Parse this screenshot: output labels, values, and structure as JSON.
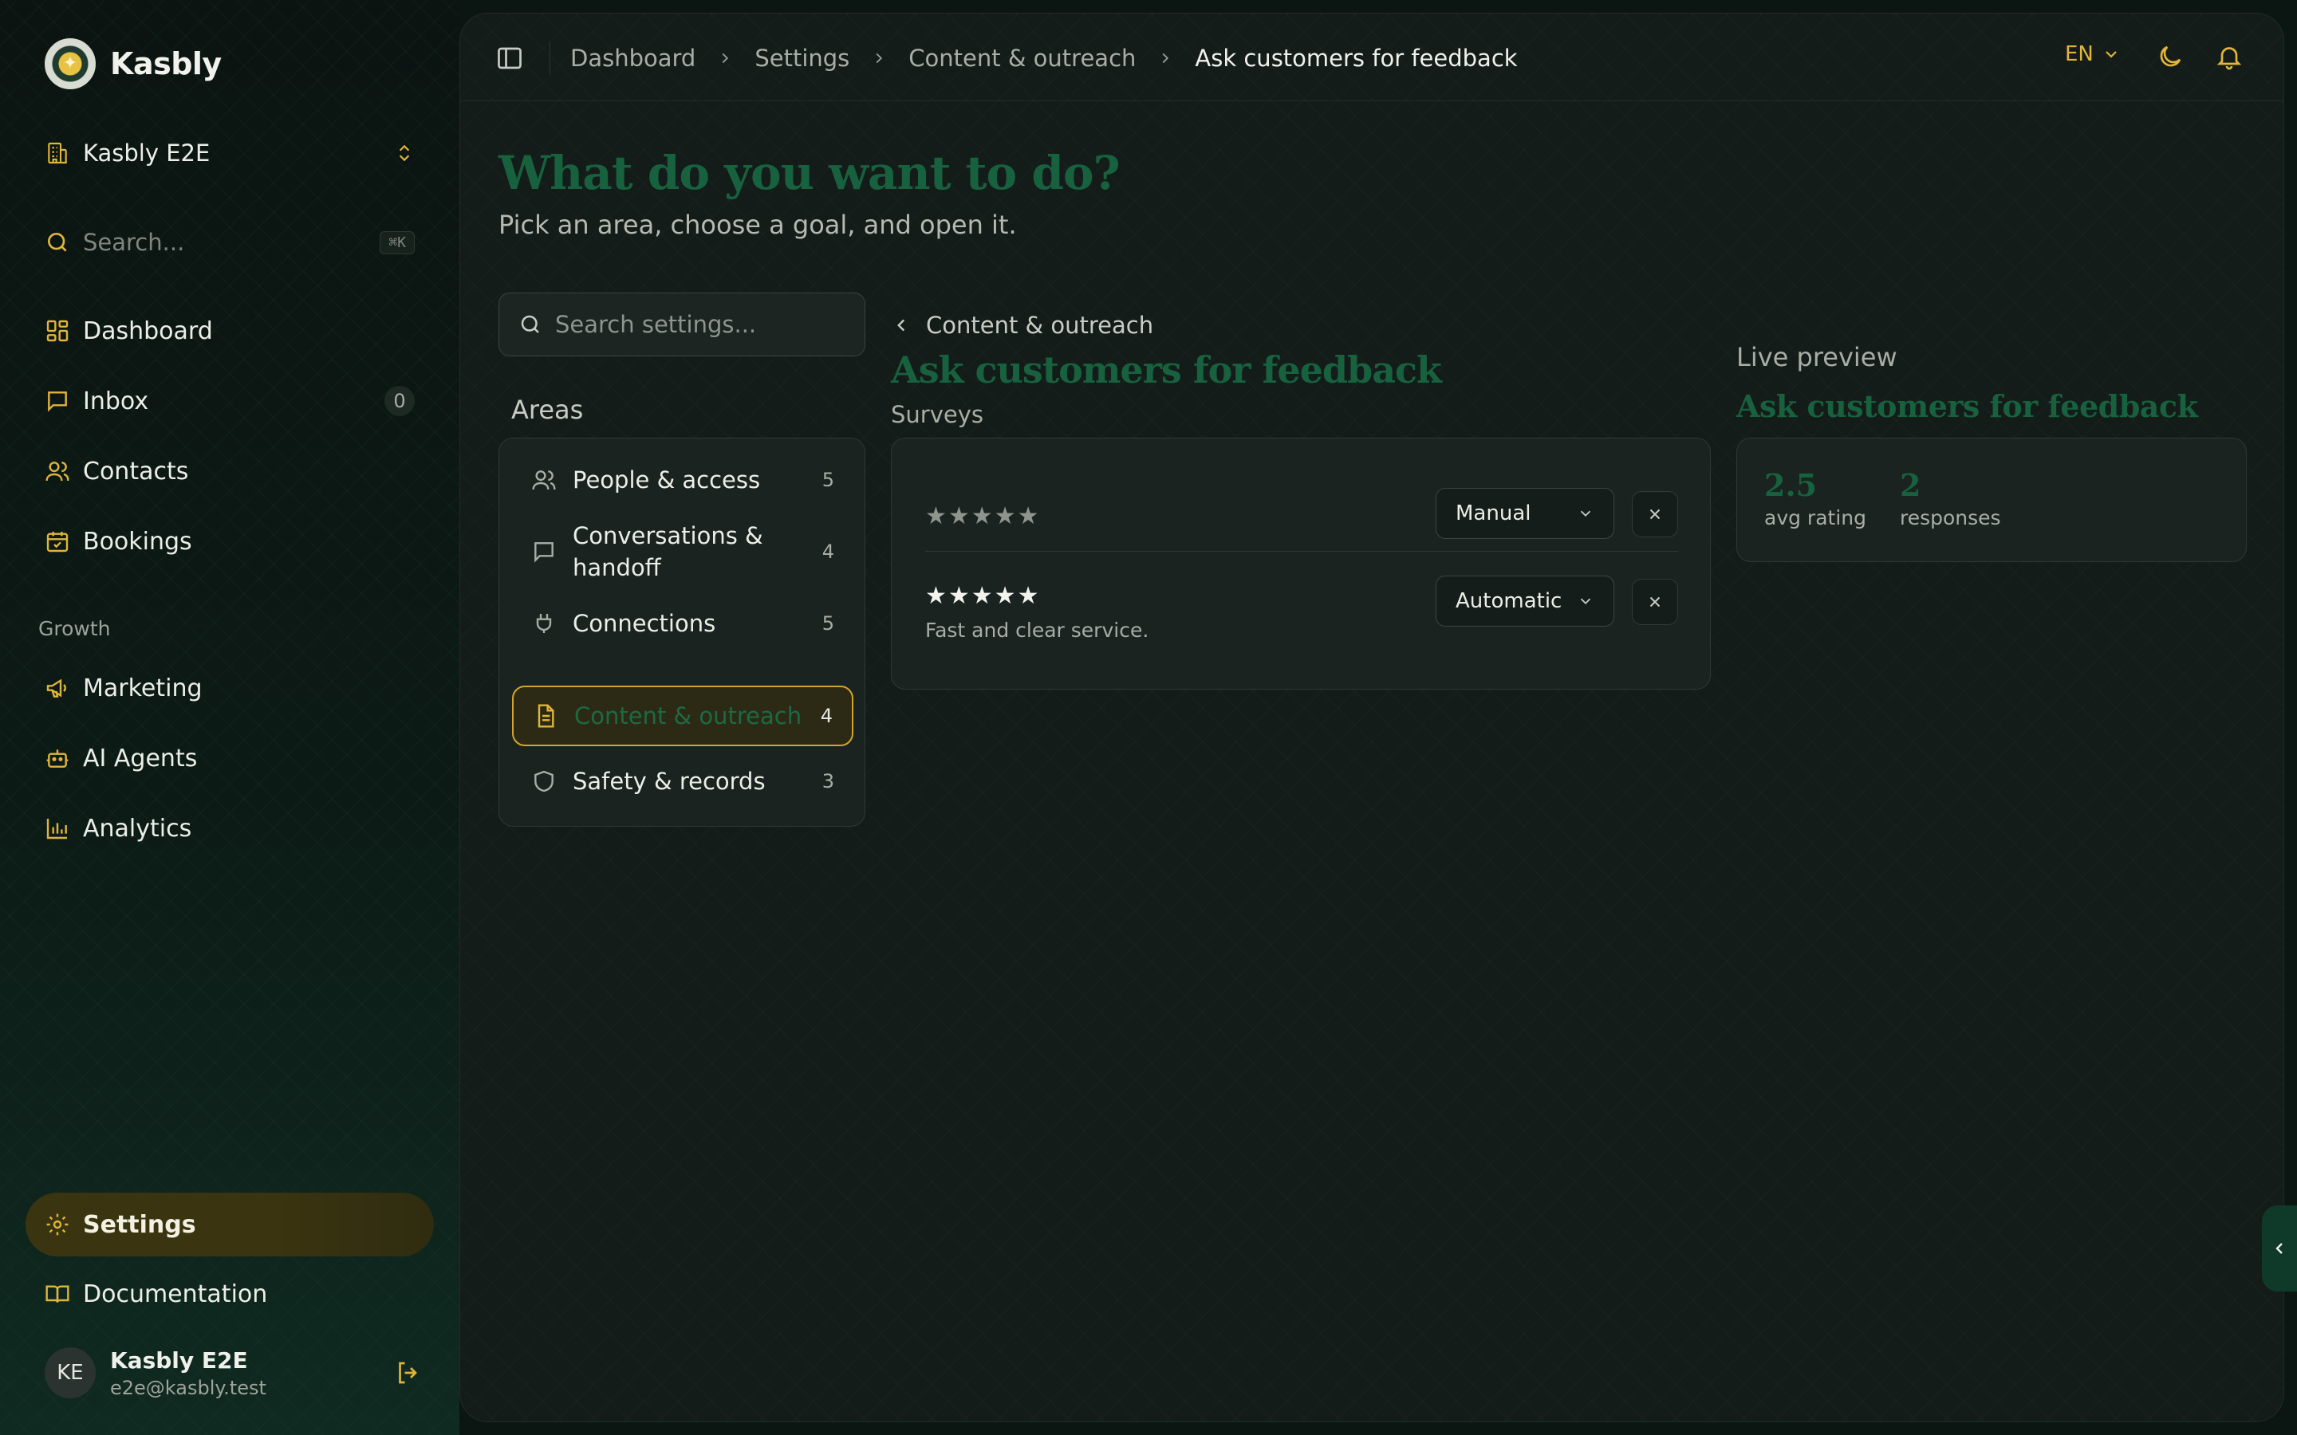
{
  "brand": {
    "name": "Kasbly",
    "logo_icon": "sparkle-logo"
  },
  "org": {
    "name": "Kasbly E2E"
  },
  "sidebar_search": {
    "placeholder": "Search...",
    "shortcut": "⌘K"
  },
  "nav": {
    "dashboard": "Dashboard",
    "inbox": "Inbox",
    "inbox_count": "0",
    "contacts": "Contacts",
    "bookings": "Bookings",
    "growth_label": "Growth",
    "marketing": "Marketing",
    "ai_agents": "AI Agents",
    "analytics": "Analytics",
    "settings": "Settings",
    "documentation": "Documentation"
  },
  "user": {
    "initials": "KE",
    "name": "Kasbly E2E",
    "email": "e2e@kasbly.test"
  },
  "breadcrumb": [
    "Dashboard",
    "Settings",
    "Content & outreach",
    "Ask customers for feedback"
  ],
  "topbar": {
    "language": "EN"
  },
  "page": {
    "title": "What do you want to do?",
    "subtitle": "Pick an area, choose a goal, and open it."
  },
  "settings_search": {
    "placeholder": "Search settings..."
  },
  "areas": {
    "label": "Areas",
    "items": [
      {
        "label": "People & access",
        "count": "5",
        "icon": "users-icon"
      },
      {
        "label": "Conversations & handoff",
        "count": "4",
        "icon": "message-icon"
      },
      {
        "label": "Connections",
        "count": "5",
        "icon": "plug-icon"
      },
      {
        "label": "Content & outreach",
        "count": "4",
        "icon": "document-icon",
        "active": true
      },
      {
        "label": "Safety & records",
        "count": "3",
        "icon": "shield-icon"
      }
    ]
  },
  "detail": {
    "back_label": "Content & outreach",
    "title": "Ask customers for feedback",
    "section": "Surveys",
    "rows": [
      {
        "stars": "★★★★★",
        "comment": "",
        "mode": "Manual"
      },
      {
        "stars": "★★★★★",
        "comment": "Fast and clear service.",
        "mode": "Automatic"
      }
    ]
  },
  "preview": {
    "label": "Live preview",
    "title": "Ask customers for feedback",
    "avg_rating": "2.5",
    "avg_rating_caption": "avg rating",
    "responses": "2",
    "responses_caption": "responses"
  },
  "colors": {
    "accent_gold": "#e0b53b",
    "brand_green": "#17613f",
    "background": "#141c19"
  }
}
